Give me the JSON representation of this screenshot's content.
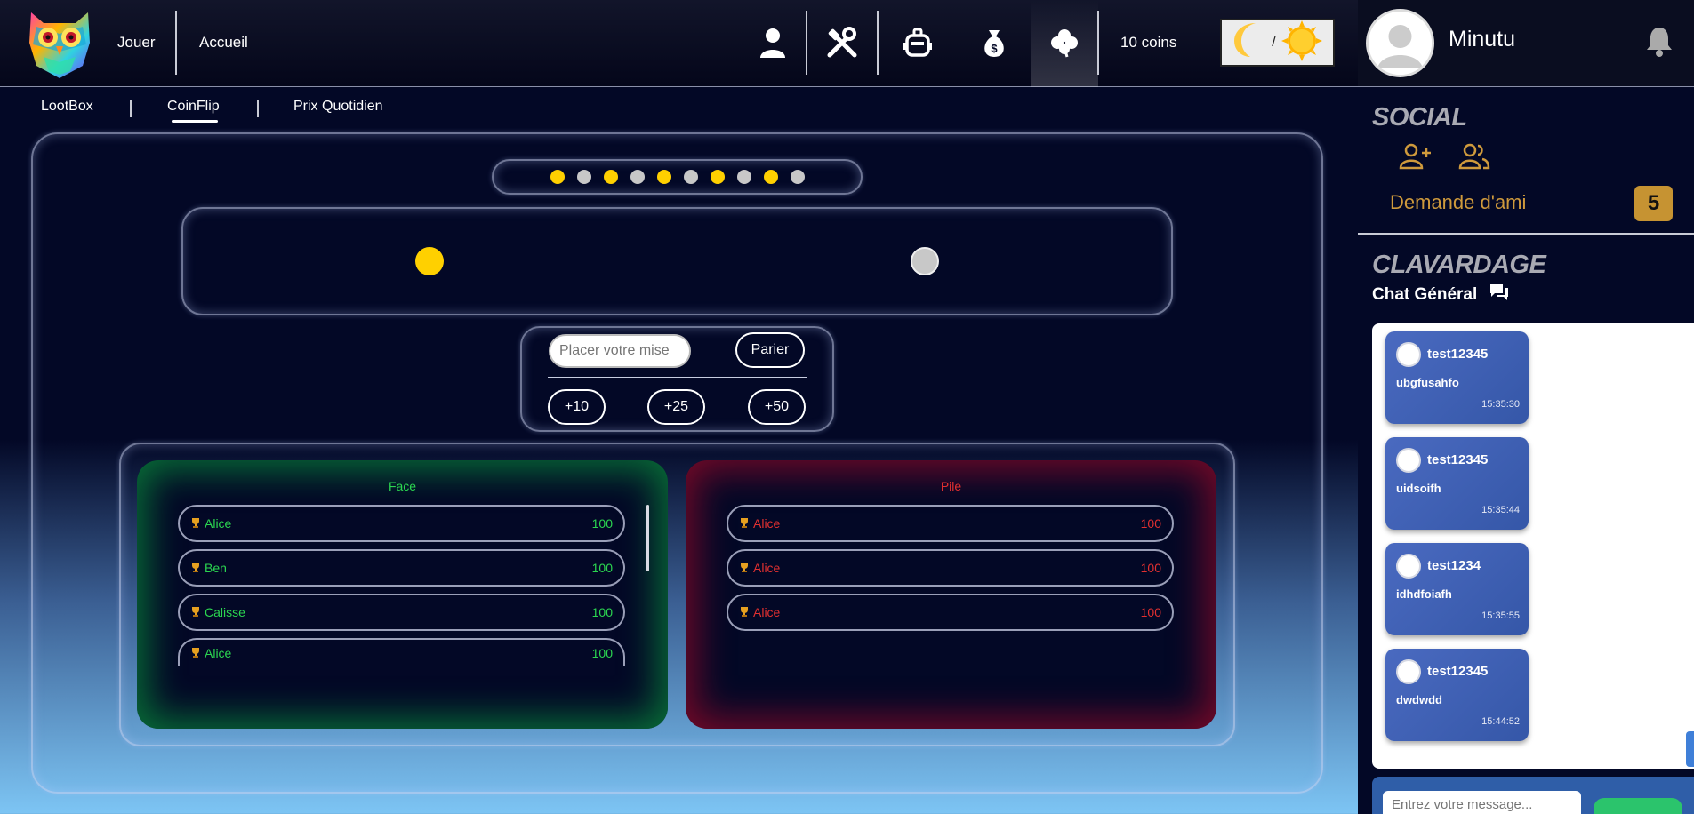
{
  "nav": {
    "jouer": "Jouer",
    "accueil": "Accueil",
    "coins": "10 coins",
    "theme_separator": "/"
  },
  "profile": {
    "username": "Minutu"
  },
  "subnav": {
    "items": [
      "LootBox",
      "CoinFlip",
      "Prix Quotidien"
    ],
    "active": "CoinFlip"
  },
  "history": [
    "gold",
    "silver",
    "gold",
    "silver",
    "gold",
    "silver",
    "gold",
    "silver",
    "gold",
    "silver"
  ],
  "bet": {
    "placeholder": "Placer votre mise",
    "submit": "Parier",
    "quick": [
      "+10",
      "+25",
      "+50"
    ]
  },
  "face": {
    "title": "Face",
    "rows": [
      {
        "name": "Alice",
        "amount": "100"
      },
      {
        "name": "Ben",
        "amount": "100"
      },
      {
        "name": "Calisse",
        "amount": "100"
      },
      {
        "name": "Alice",
        "amount": "100"
      }
    ]
  },
  "pile": {
    "title": "Pile",
    "rows": [
      {
        "name": "Alice",
        "amount": "100"
      },
      {
        "name": "Alice",
        "amount": "100"
      },
      {
        "name": "Alice",
        "amount": "100"
      }
    ]
  },
  "social": {
    "title": "SOCIAL",
    "friend_request_label": "Demande d'ami",
    "friend_request_count": "5"
  },
  "chat": {
    "title": "CLAVARDAGE",
    "channel": "Chat Général",
    "input_placeholder": "Entrez votre message...",
    "messages": [
      {
        "user": "test12345",
        "text": "ubgfusahfo",
        "time": "15:35:30"
      },
      {
        "user": "test12345",
        "text": "uidsoifh",
        "time": "15:35:44"
      },
      {
        "user": "test1234",
        "text": "idhdfoiafh",
        "time": "15:35:55"
      },
      {
        "user": "test12345",
        "text": "dwdwdd",
        "time": "15:44:52"
      }
    ]
  },
  "colors": {
    "gold": "#ffd000",
    "silver": "#c8c8c8",
    "face_green": "#2bd650",
    "pile_red": "#e23030",
    "accent_orange": "#cf9a3c"
  }
}
